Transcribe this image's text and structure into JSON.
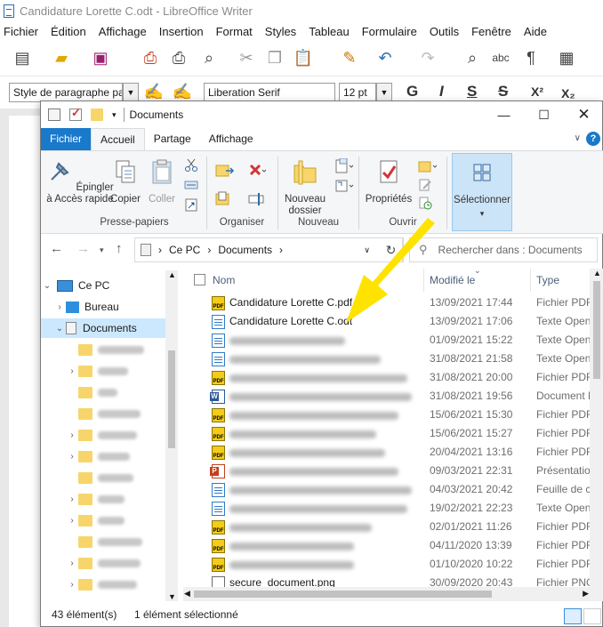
{
  "writer": {
    "title": "Candidature Lorette C.odt - LibreOffice Writer",
    "menu": [
      "Fichier",
      "Édition",
      "Affichage",
      "Insertion",
      "Format",
      "Styles",
      "Tableau",
      "Formulaire",
      "Outils",
      "Fenêtre",
      "Aide"
    ],
    "paragraph_style": "Style de paragraphe par",
    "font_name": "Liberation Serif",
    "font_size": "12 pt",
    "format_buttons": [
      "G",
      "I",
      "S",
      "S",
      "X²",
      "X₂"
    ]
  },
  "explorer": {
    "title": "Documents",
    "ribbon_tabs": [
      "Fichier",
      "Accueil",
      "Partage",
      "Affichage"
    ],
    "ribbon": {
      "pin_label": "Épingler à Accès rapide",
      "copy_label": "Copier",
      "paste_label": "Coller",
      "group_clipboard": "Presse-papiers",
      "group_organize": "Organiser",
      "new_folder_label": "Nouveau dossier",
      "group_new": "Nouveau",
      "properties_label": "Propriétés",
      "group_open": "Ouvrir",
      "select_label": "Sélectionner"
    },
    "address": {
      "crumbs": [
        "Ce PC",
        "Documents"
      ],
      "search_placeholder": "Rechercher dans : Documents"
    },
    "nav": {
      "this_pc": "Ce PC",
      "desktop": "Bureau",
      "documents": "Documents"
    },
    "columns": {
      "name": "Nom",
      "modified": "Modifié le",
      "type": "Type"
    },
    "files": [
      {
        "name": "Candidature Lorette C.pdf",
        "modified": "13/09/2021 17:44",
        "type": "Fichier PDF",
        "icon": "pdf-icon"
      },
      {
        "name": "Candidature Lorette C.odt",
        "modified": "13/09/2021 17:06",
        "type": "Texte OpenD",
        "icon": "odt-icon"
      },
      {
        "name": "",
        "modified": "01/09/2021 15:22",
        "type": "Texte OpenD",
        "icon": "odt-icon"
      },
      {
        "name": "",
        "modified": "31/08/2021 21:58",
        "type": "Texte OpenD",
        "icon": "odt-icon"
      },
      {
        "name": "",
        "modified": "31/08/2021 20:00",
        "type": "Fichier PDF",
        "icon": "pdf-icon"
      },
      {
        "name": "",
        "modified": "31/08/2021 19:56",
        "type": "Document M",
        "icon": "word-icon"
      },
      {
        "name": "",
        "modified": "15/06/2021 15:30",
        "type": "Fichier PDF",
        "icon": "pdf-icon"
      },
      {
        "name": "",
        "modified": "15/06/2021 15:27",
        "type": "Fichier PDF",
        "icon": "pdf-icon"
      },
      {
        "name": "",
        "modified": "20/04/2021 13:16",
        "type": "Fichier PDF",
        "icon": "pdf-icon"
      },
      {
        "name": "",
        "modified": "09/03/2021 22:31",
        "type": "Présentation",
        "icon": "powerpoint-icon"
      },
      {
        "name": "",
        "modified": "04/03/2021 20:42",
        "type": "Feuille de ca",
        "icon": "odt-icon"
      },
      {
        "name": "",
        "modified": "19/02/2021 22:23",
        "type": "Texte OpenD",
        "icon": "odt-icon"
      },
      {
        "name": "",
        "modified": "02/01/2021 11:26",
        "type": "Fichier PDF",
        "icon": "pdf-icon"
      },
      {
        "name": "",
        "modified": "04/11/2020 13:39",
        "type": "Fichier PDF",
        "icon": "pdf-icon"
      },
      {
        "name": "",
        "modified": "01/10/2020 10:22",
        "type": "Fichier PDF",
        "icon": "pdf-icon"
      },
      {
        "name": "secure_document.png",
        "modified": "30/09/2020 20:43",
        "type": "Fichier PNG",
        "icon": "png-icon"
      }
    ],
    "status": {
      "count": "43 élément(s)",
      "selected": "1 élément sélectionné"
    }
  },
  "colors": {
    "file_tab": "#1979ca",
    "selection": "#cce8ff",
    "arrow": "#ffe300",
    "pdf_icon": "#f3cc1a"
  }
}
